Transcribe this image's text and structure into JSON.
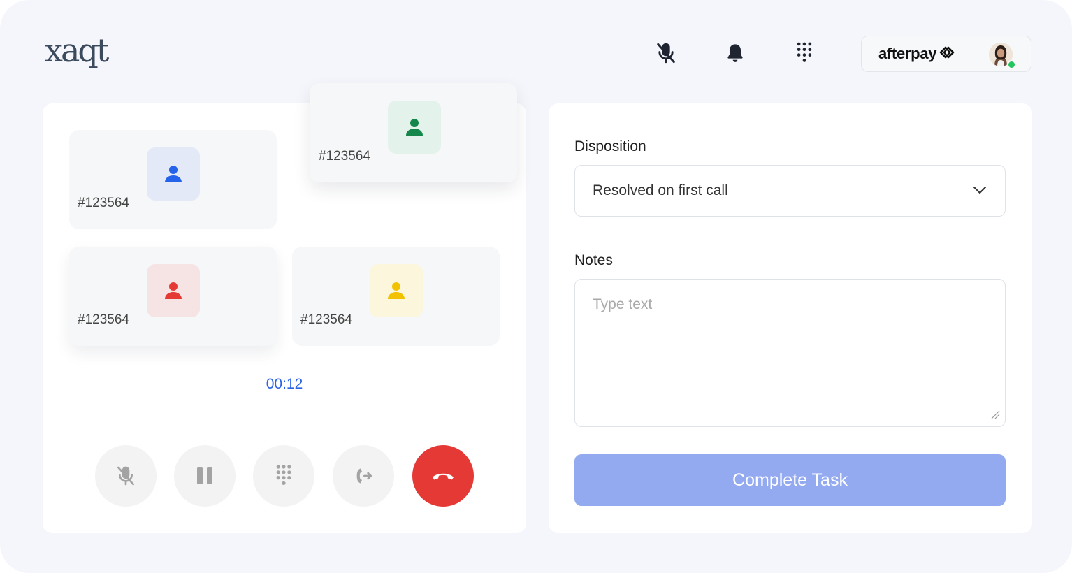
{
  "header": {
    "logo_text": "xaqt",
    "brand_name": "afterpay",
    "icons": [
      "mic-off-icon",
      "bell-icon",
      "dialpad-icon"
    ]
  },
  "call": {
    "participants": [
      {
        "id": "#123564",
        "color": "#2563eb",
        "bg": "#e3e9f7"
      },
      {
        "id": "#123564",
        "color": "#16874b",
        "bg": "#e3f2ea"
      },
      {
        "id": "#123564",
        "color": "#e53935",
        "bg": "#f6e3e4"
      },
      {
        "id": "#123564",
        "color": "#f2c200",
        "bg": "#fbf6dc"
      }
    ],
    "timer": "00:12",
    "controls": [
      "mute-icon",
      "pause-icon",
      "keypad-icon",
      "transfer-icon",
      "end-call-icon"
    ]
  },
  "form": {
    "disposition_label": "Disposition",
    "disposition_value": "Resolved on first call",
    "notes_label": "Notes",
    "notes_placeholder": "Type text",
    "complete_label": "Complete Task"
  },
  "colors": {
    "accent": "#2b63e6",
    "end_call": "#e53935",
    "complete_button": "#93a9f0"
  }
}
